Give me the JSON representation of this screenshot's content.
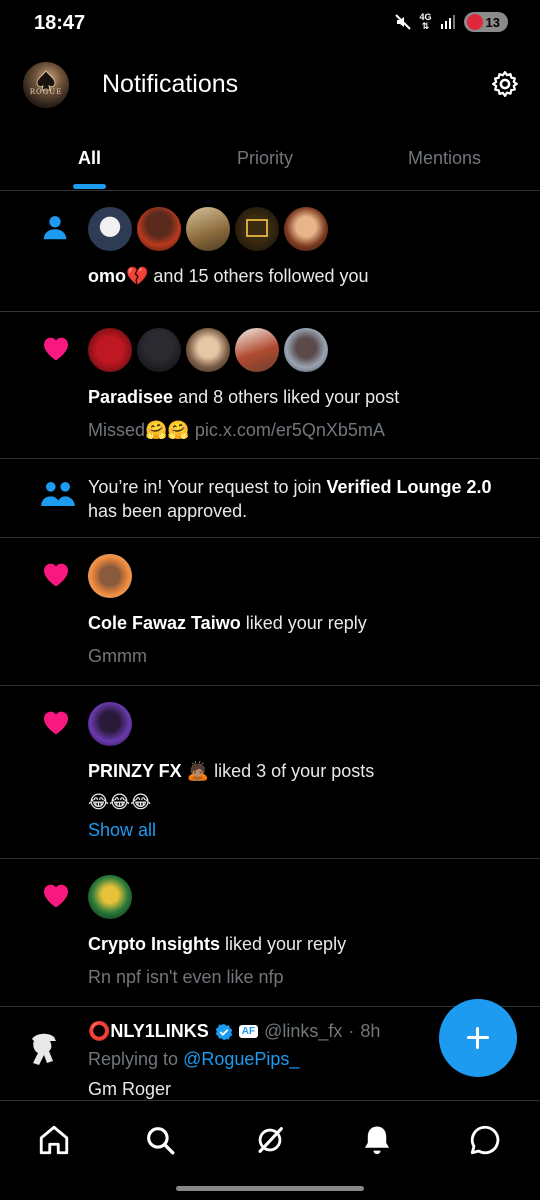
{
  "status": {
    "time": "18:47",
    "network": "4G",
    "battery": "13"
  },
  "header": {
    "title": "Notifications"
  },
  "tabs": [
    {
      "label": "All"
    },
    {
      "label": "Priority"
    },
    {
      "label": "Mentions"
    }
  ],
  "notifications": [
    {
      "type": "follow",
      "actor": "omo",
      "actor_emoji": "💔",
      "text": " and 15 others followed you"
    },
    {
      "type": "like",
      "actor": "Paradisee",
      "text": " and 8 others liked your post",
      "snippet_text": "Missed",
      "snippet_emoji": "🤗🤗",
      "snippet_link": "pic.x.com/er5QnXb5mA"
    },
    {
      "type": "community",
      "text_pre": "You’re in! Your request to join ",
      "community": "Verified Lounge 2.0",
      "text_post": "has been approved."
    },
    {
      "type": "like",
      "actor": "Cole Fawaz Taiwo",
      "text": " liked your reply",
      "snippet_text": "Gmmm"
    },
    {
      "type": "like",
      "actor": "PRINZY FX",
      "actor_emoji": "🙇🏽",
      "text": " liked 3 of your posts",
      "snippet_emoji": "😂😂😂",
      "show_all": "Show all"
    },
    {
      "type": "like",
      "actor": "Crypto Insights",
      "text": " liked your reply",
      "snippet_text": "Rn npf isn't even like nfp"
    }
  ],
  "reply": {
    "name": "⭕NLY1LINKS",
    "affiliate_badge": "AF",
    "handle": "@links_fx",
    "sep": "·",
    "time": "8h",
    "replying_label": "Replying to ",
    "replying_handle": "@RoguePips_",
    "text": "Gm Roger"
  },
  "misc": {
    "avatar_logo": "ROGUE"
  },
  "colors": {
    "accent": "#1d9bf0",
    "like": "#f91880",
    "bg": "#000000",
    "muted": "#71767b",
    "divider": "#2f3336"
  },
  "icons": {
    "nav": [
      "home-icon",
      "search-icon",
      "grok-icon",
      "notifications-bell-icon",
      "messages-icon"
    ],
    "follow": "person-icon",
    "like": "heart-icon",
    "community": "people-icon",
    "settings": "gear-icon",
    "compose": "plus-icon"
  }
}
